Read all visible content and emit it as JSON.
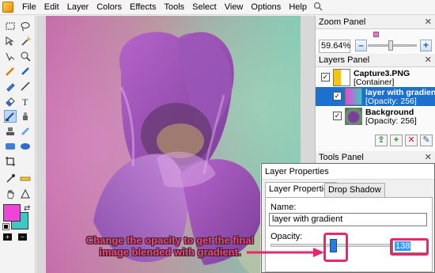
{
  "menu": {
    "items": [
      "File",
      "Edit",
      "Layer",
      "Colors",
      "Effects",
      "Tools",
      "Select",
      "View",
      "Options",
      "Help"
    ],
    "search_icon": "search-icon"
  },
  "toolbox": {
    "tools": [
      "rectangle-select-icon",
      "lasso-icon",
      "move-icon",
      "magic-wand-icon",
      "zoom-icon",
      "pan-icon",
      "pencil-icon",
      "paint-bucket-icon",
      "brush-icon",
      "line-icon",
      "eraser-icon",
      "text-icon",
      "gradient-icon",
      "clone-icon",
      "stamp-icon",
      "recolor-icon",
      "rounded-rect-icon",
      "ellipse-icon",
      "crop-icon",
      "color-picker-icon",
      "ruler-icon",
      "hand-icon",
      "shape-icon"
    ],
    "primary_color": "#ee44d8",
    "secondary_color": "#3ec8c0"
  },
  "zoom_panel": {
    "title": "Zoom Panel",
    "value": "59.64%",
    "minus": "–",
    "plus": "+"
  },
  "layers_panel": {
    "title": "Layers Panel",
    "layers": [
      {
        "name": "Capture3.PNG",
        "sub": "[Container]"
      },
      {
        "name": "layer with gradient",
        "sub": "[Opacity: 256]"
      },
      {
        "name": "Background",
        "sub": "[Opacity: 256]"
      }
    ]
  },
  "tools_panel": {
    "title": "Tools Panel"
  },
  "dialog": {
    "title": "Layer Properties",
    "tabs": [
      "Layer Properties",
      "Drop Shadow"
    ],
    "name_label": "Name:",
    "name_value": "layer with gradient",
    "opacity_label": "Opacity:",
    "opacity_value": "138",
    "opacity_fraction": 0.54
  },
  "annotation": {
    "text": "Change the opacity to get the final image blended with gradient.",
    "color": "#ff3d7f"
  }
}
